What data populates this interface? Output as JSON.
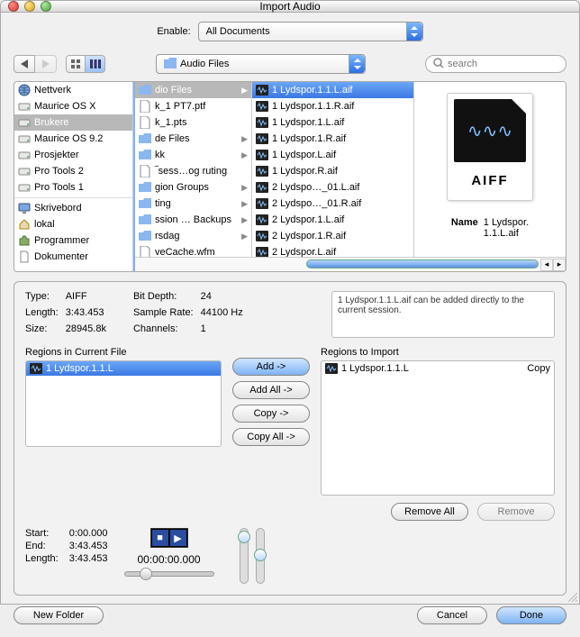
{
  "window": {
    "title": "Import Audio"
  },
  "enable": {
    "label": "Enable:",
    "value": "All Documents"
  },
  "path_popup": {
    "value": "Audio Files"
  },
  "search": {
    "placeholder": "search"
  },
  "sidebar": {
    "items": [
      {
        "label": "Nettverk",
        "icon": "globe"
      },
      {
        "label": "Maurice OS X",
        "icon": "hdd"
      },
      {
        "label": "Brukere",
        "icon": "hdd",
        "selected": true
      },
      {
        "label": "Maurice OS 9.2",
        "icon": "hdd"
      },
      {
        "label": "Prosjekter",
        "icon": "hdd"
      },
      {
        "label": "Pro Tools 2",
        "icon": "hdd"
      },
      {
        "label": "Pro Tools 1",
        "icon": "hdd"
      }
    ],
    "items2": [
      {
        "label": "Skrivebord",
        "icon": "desktop"
      },
      {
        "label": "lokal",
        "icon": "home"
      },
      {
        "label": "Programmer",
        "icon": "apps"
      },
      {
        "label": "Dokumenter",
        "icon": "docs"
      }
    ]
  },
  "col1": {
    "items": [
      {
        "label": "dio Files",
        "folder": true,
        "chev": true,
        "selected": true
      },
      {
        "label": "k_1 PT7.ptf",
        "folder": false
      },
      {
        "label": "k_1.pts",
        "folder": false
      },
      {
        "label": "de Files",
        "folder": true,
        "chev": true
      },
      {
        "label": "kk",
        "folder": true,
        "chev": true
      },
      {
        "label": "‾sess…og ruting",
        "folder": false
      },
      {
        "label": "gion Groups",
        "folder": true,
        "chev": true
      },
      {
        "label": "ting",
        "folder": true,
        "chev": true
      },
      {
        "label": "ssion … Backups",
        "folder": true,
        "chev": true
      },
      {
        "label": "rsdag",
        "folder": true,
        "chev": true
      },
      {
        "label": "veCache.wfm",
        "folder": false
      }
    ]
  },
  "col2": {
    "items": [
      {
        "label": "1 Lydspor.1.1.L.aif",
        "selected": true
      },
      {
        "label": "1 Lydspor.1.1.R.aif"
      },
      {
        "label": "1 Lydspor.1.L.aif"
      },
      {
        "label": "1 Lydspor.1.R.aif"
      },
      {
        "label": "1 Lydspor.L.aif"
      },
      {
        "label": "1 Lydspor.R.aif"
      },
      {
        "label": "2 Lydspo…_01.L.aif"
      },
      {
        "label": "2 Lydspo…_01.R.aif"
      },
      {
        "label": "2 Lydspor.1.L.aif"
      },
      {
        "label": "2 Lydspor.1.R.aif"
      },
      {
        "label": "2 Lydspor.L.aif"
      }
    ]
  },
  "preview": {
    "format": "AIFF",
    "name_label": "Name",
    "name_value": "1 Lydspor.\n1.1.L.aif"
  },
  "meta": {
    "type_k": "Type:",
    "type_v": "AIFF",
    "length_k": "Length:",
    "length_v": "3:43.453",
    "size_k": "Size:",
    "size_v": "28945.8k",
    "bitdepth_k": "Bit Depth:",
    "bitdepth_v": "24",
    "srate_k": "Sample Rate:",
    "srate_v": "44100 Hz",
    "channels_k": "Channels:",
    "channels_v": "1"
  },
  "info_text": "1 Lydspor.1.1.L.aif can be added directly to the current session.",
  "regions_current_label": "Regions in Current File",
  "regions_import_label": "Regions to Import",
  "current_regions": [
    {
      "label": "1 Lydspor.1.1.L"
    }
  ],
  "import_regions": [
    {
      "label": "1 Lydspor.1.1.L",
      "mode": "Copy"
    }
  ],
  "buttons": {
    "add": "Add ->",
    "add_all": "Add All ->",
    "copy": "Copy ->",
    "copy_all": "Copy All ->",
    "remove_all": "Remove All",
    "remove": "Remove",
    "new_folder": "New Folder",
    "cancel": "Cancel",
    "done": "Done"
  },
  "time": {
    "start_k": "Start:",
    "start_v": "0:00.000",
    "end_k": "End:",
    "end_v": "3:43.453",
    "length_k": "Length:",
    "length_v": "3:43.453",
    "timecode": "00:00:00.000"
  },
  "chart_data": null
}
